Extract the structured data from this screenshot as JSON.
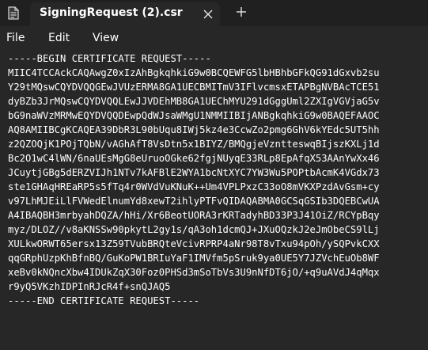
{
  "tab": {
    "title": "SigningRequest (2).csr"
  },
  "menu": {
    "file": "File",
    "edit": "Edit",
    "view": "View"
  },
  "icons": {
    "app": "notepad-icon",
    "close": "close-icon",
    "new_tab": "plus-icon"
  },
  "editor": {
    "lines": [
      "-----BEGIN CERTIFICATE REQUEST-----",
      "MIIC4TCCAckCAQAwgZ0xIzAhBgkqhkiG9w0BCQEWFG5lbHBhbGFkQG91dGxvb2su",
      "Y29tMQswCQYDVQQGEwJVUzERMA8GA1UECBMITmV3IFlvcmsxETAPBgNVBAcTCE51",
      "dyBZb3JrMQswCQYDVQQLEwJJVDEhMB8GA1UEChMYU291dGggUml2ZXIgVGVjaG5v",
      "bG9naWVzMRMwEQYDVQQDEwpQdWJsaWMgU1NMMIIBIjANBgkqhkiG9w0BAQEFAAOC",
      "AQ8AMIIBCgKCAQEA39DbR3L90bUqu8IWj5kz4e3CcwZo2pmg6GhV6kYEdc5UT5hh",
      "z2QZOQjK1POjTQbN/vAGhAfT8VsDtn5x1BIYZ/BMQgjeVzntteswqBIjszKXLj1d",
      "Bc2O1wC4lWN/6naUEsMgG8eUruoOGke62fgjNUyqE33RLp8EpAfqX53AAnYwXx46",
      "JCuytjGBg5dERZVIJh1NTv7kAFBlE2WYA1bcNtXYC7YW3Wu5POPtbAcmK4VGdx73",
      "ste1GHAqHREaRP5s5fTq4r0WVdVuKNuK++Um4VPLPxzC33oO8mVKXPzdAvGsm+cy",
      "v97LhMJEiLlFVWedElnumYd8xewT2ihlyPTFvQIDAQABMA0GCSqGSIb3DQEBCwUA",
      "A4IBAQBH3mrbyahDQZA/hHi/Xr6BeotUORA3rKRTadyhBD33P3J41OiZ/RCYpBqy",
      "myz/DLOZ//v8aKNSSw90pkytL2gy1s/qA3oh1dcmQJ+JXuOQzkJ2eJmObeCS9lLj",
      "XULkwORWT65ersx13Z59TVubBRQteVcivRPRP4aNr98T8vTxu94pOh/ySQPvkCXX",
      "qqGRphUzpKhBfnBQ/GuKoPW1BRIuYaF1IMVfm5pSruk9ya0UE5Y7JZVchEuOb8WF",
      "xeBv0kNQncXbw4IDUkZqX30Foz0PHSd3mSoTbVs3U9nNfDT6jO/+q9uAVdJ4qMqx",
      "r9yQ5VKzhIDPInRJcR4f+snQJAQ5",
      "-----END CERTIFICATE REQUEST-----"
    ]
  }
}
